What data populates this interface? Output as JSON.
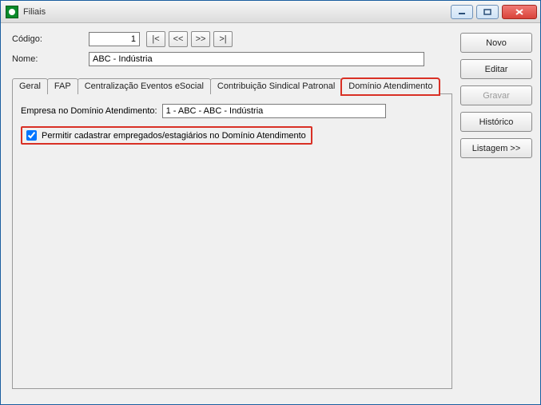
{
  "window": {
    "title": "Filiais"
  },
  "form": {
    "codigo_label": "Código:",
    "codigo_value": "1",
    "nome_label": "Nome:",
    "nome_value": "ABC - Indústria"
  },
  "nav": {
    "first": "|<",
    "prev": "<<",
    "next": ">>",
    "last": ">|"
  },
  "tabs": {
    "geral": "Geral",
    "fap": "FAP",
    "central": "Centralização Eventos eSocial",
    "contrib": "Contribuição Sindical Patronal",
    "dominio": "Domínio Atendimento"
  },
  "panel": {
    "empresa_label": "Empresa no Domínio Atendimento:",
    "empresa_value": "1 - ABC - ABC - Indústria",
    "checkbox_label": "Permitir cadastrar empregados/estagiários no Domínio Atendimento"
  },
  "buttons": {
    "novo": "Novo",
    "editar": "Editar",
    "gravar": "Gravar",
    "historico": "Histórico",
    "listagem": "Listagem >>"
  }
}
